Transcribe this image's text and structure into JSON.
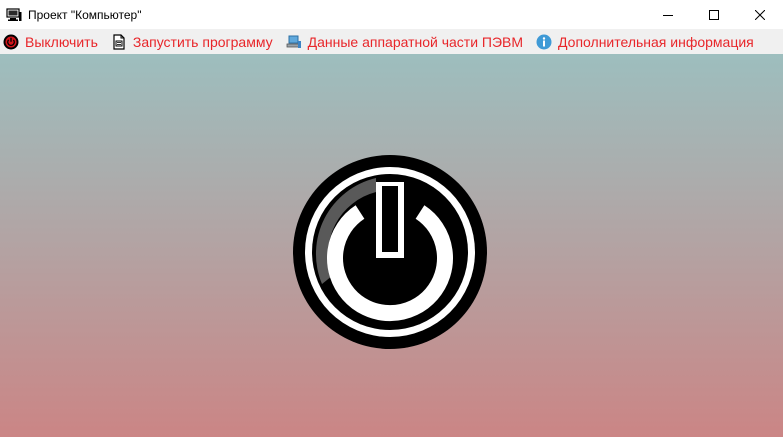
{
  "window": {
    "title": "Проект \"Компьютер\"",
    "app_icon": "computer-icon"
  },
  "caption": {
    "minimize_icon": "minimize-icon",
    "maximize_icon": "maximize-icon",
    "close_icon": "close-icon"
  },
  "menu": {
    "text_color": "#e8262a",
    "items": [
      {
        "label": "Выключить",
        "icon": "power-off-icon"
      },
      {
        "label": "Запустить программу",
        "icon": "run-program-icon"
      },
      {
        "label": "Данные аппаратной части ПЭВМ",
        "icon": "hardware-icon"
      },
      {
        "label": "Дополнительная информация",
        "icon": "info-icon"
      }
    ]
  },
  "content": {
    "gradient_top": "#9dbebe",
    "gradient_bottom": "#cb8585",
    "center_icon": "power-button-icon"
  }
}
